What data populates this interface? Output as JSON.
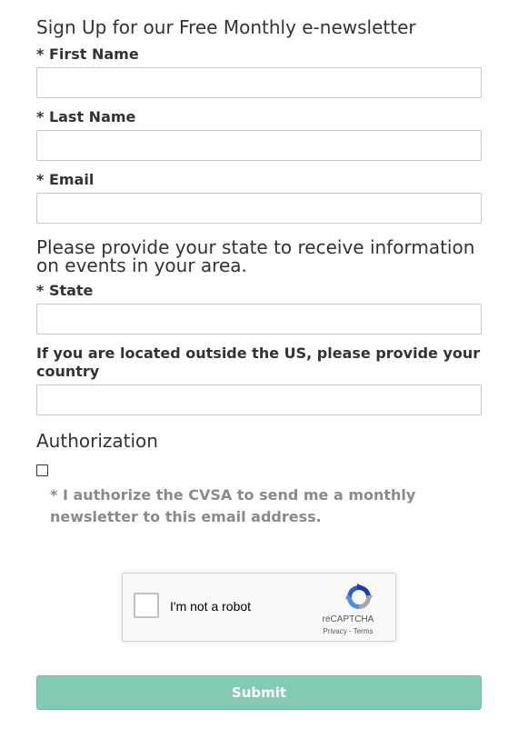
{
  "form": {
    "heading": "Sign Up for our Free Monthly e-newsletter",
    "first_name_label": "* First Name",
    "first_name_value": "",
    "last_name_label": "* Last Name",
    "last_name_value": "",
    "email_label": "* Email",
    "email_value": "",
    "state_heading": "Please provide your state to receive information on events in your area.",
    "state_label": "* State",
    "state_value": "",
    "country_label": "If you are located outside the US, please provide your country",
    "country_value": "",
    "authorization_heading": "Authorization",
    "authorization_text": "* I authorize the CVSA to send me a monthly newsletter to this email address.",
    "authorization_checked": false
  },
  "recaptcha": {
    "label": "I'm not a robot",
    "brand": "reCAPTCHA",
    "privacy_link": "Privacy",
    "separator": " - ",
    "terms_link": "Terms",
    "icon": "recaptcha-logo-icon"
  },
  "submit": {
    "label": "Submit",
    "color": "#82cbb0"
  }
}
